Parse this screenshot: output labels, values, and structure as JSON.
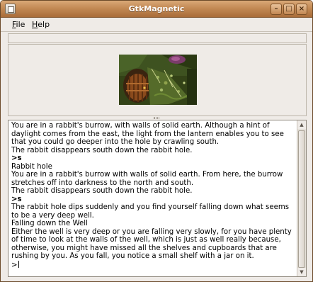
{
  "window": {
    "title": "GtkMagnetic",
    "controls": {
      "minimize": "–",
      "maximize": "□",
      "close": "×"
    }
  },
  "menu": {
    "file": {
      "label": "File",
      "mnemonic": "F",
      "rest": "ile"
    },
    "help": {
      "label": "Help",
      "mnemonic": "H",
      "rest": "elp"
    }
  },
  "scene": {
    "description_icon": "game-scene-image"
  },
  "transcript": [
    {
      "type": "text",
      "text": "You are in a rabbit's burrow, with walls of solid earth. Although a hint of daylight comes from the east, the light from the lantern enables you to see that you could go deeper into the hole by crawling south."
    },
    {
      "type": "text",
      "text": "The rabbit disappears south down the rabbit hole."
    },
    {
      "type": "command",
      "text": ">s"
    },
    {
      "type": "text",
      "text": "Rabbit hole"
    },
    {
      "type": "text",
      "text": "You are in a rabbit's burrow with walls of solid earth. From here, the burrow stretches off into darkness to the north and south."
    },
    {
      "type": "text",
      "text": "The rabbit disappears south down the rabbit hole."
    },
    {
      "type": "command",
      "text": ">s"
    },
    {
      "type": "text",
      "text": "The rabbit hole dips suddenly and you find yourself falling down what seems to be a very deep well."
    },
    {
      "type": "text",
      "text": "Falling down the Well"
    },
    {
      "type": "text",
      "text": "Either the well is very deep or you are falling very slowly, for you have plenty of time to look at the walls of the well, which is just as well really because, otherwise, you might have missed all the shelves and cupboards that are rushing by you. As you fall, you notice a small shelf with a jar on it."
    }
  ],
  "input": {
    "prompt": ">",
    "value": ""
  },
  "scrollbar": {
    "up": "▲",
    "down": "▼",
    "position": 0.95
  }
}
